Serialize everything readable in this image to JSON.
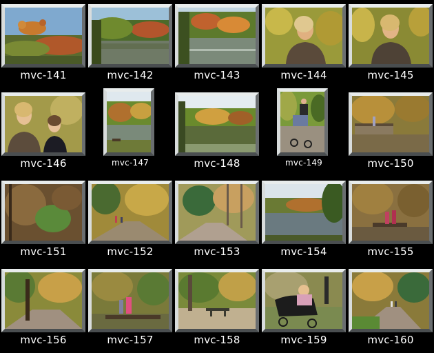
{
  "thumbnails": [
    {
      "label": "mvc-141"
    },
    {
      "label": "mvc-142"
    },
    {
      "label": "mvc-143"
    },
    {
      "label": "mvc-144"
    },
    {
      "label": "mvc-145"
    },
    {
      "label": "mvc-146"
    },
    {
      "label": "mvc-147"
    },
    {
      "label": "mvc-148"
    },
    {
      "label": "mvc-149"
    },
    {
      "label": "mvc-150"
    },
    {
      "label": "mvc-151"
    },
    {
      "label": "mvc-152"
    },
    {
      "label": "mvc-153"
    },
    {
      "label": "mvc-154"
    },
    {
      "label": "mvc-155"
    },
    {
      "label": "mvc-156"
    },
    {
      "label": "mvc-157"
    },
    {
      "label": "mvc-158"
    },
    {
      "label": "mvc-159"
    },
    {
      "label": "mvc-160"
    }
  ]
}
